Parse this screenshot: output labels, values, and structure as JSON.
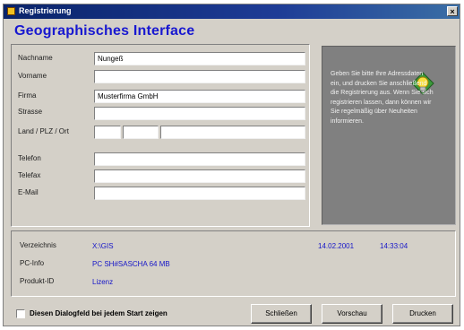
{
  "window": {
    "title": "Registrierung",
    "close_glyph": "×",
    "icon": "app-icon"
  },
  "heading": "Geographisches Interface",
  "form": {
    "fields": [
      {
        "label": "Nachname",
        "value": "Nungeß"
      },
      {
        "label": "Vorname",
        "value": ""
      },
      {
        "label": "Firma",
        "value": "Musterfirma GmbH"
      },
      {
        "label": "Strasse",
        "value": ""
      },
      {
        "label": "Land / PLZ / Ort",
        "value": ""
      },
      {
        "label": "Telefon",
        "value": ""
      },
      {
        "label": "Telefax",
        "value": ""
      },
      {
        "label": "E-Mail",
        "value": ""
      }
    ]
  },
  "info": {
    "text": "Geben Sie bitte Ihre Adressdaten ein, und drucken Sie anschließend die Registrierung aus. Wenn Sie sich registrieren lassen, dann können wir Sie regelmäßig über Neuheiten informieren.",
    "icon": "lightbulb-icon"
  },
  "status": {
    "verzeichnis_label": "Verzeichnis",
    "verzeichnis_value": "X:\\GIS",
    "date": "14.02.2001",
    "time": "14:33:04",
    "pcinfo_label": "PC-Info",
    "pcinfo_value": "PC SH#SASCHA 64 MB",
    "produkt_label": "Produkt-ID",
    "produkt_value": "Lizenz"
  },
  "checkbox": {
    "label": "Diesen Dialogfeld bei jedem Start zeigen",
    "checked": false
  },
  "buttons": {
    "close": "Schließen",
    "preview": "Vorschau",
    "print": "Drucken"
  }
}
